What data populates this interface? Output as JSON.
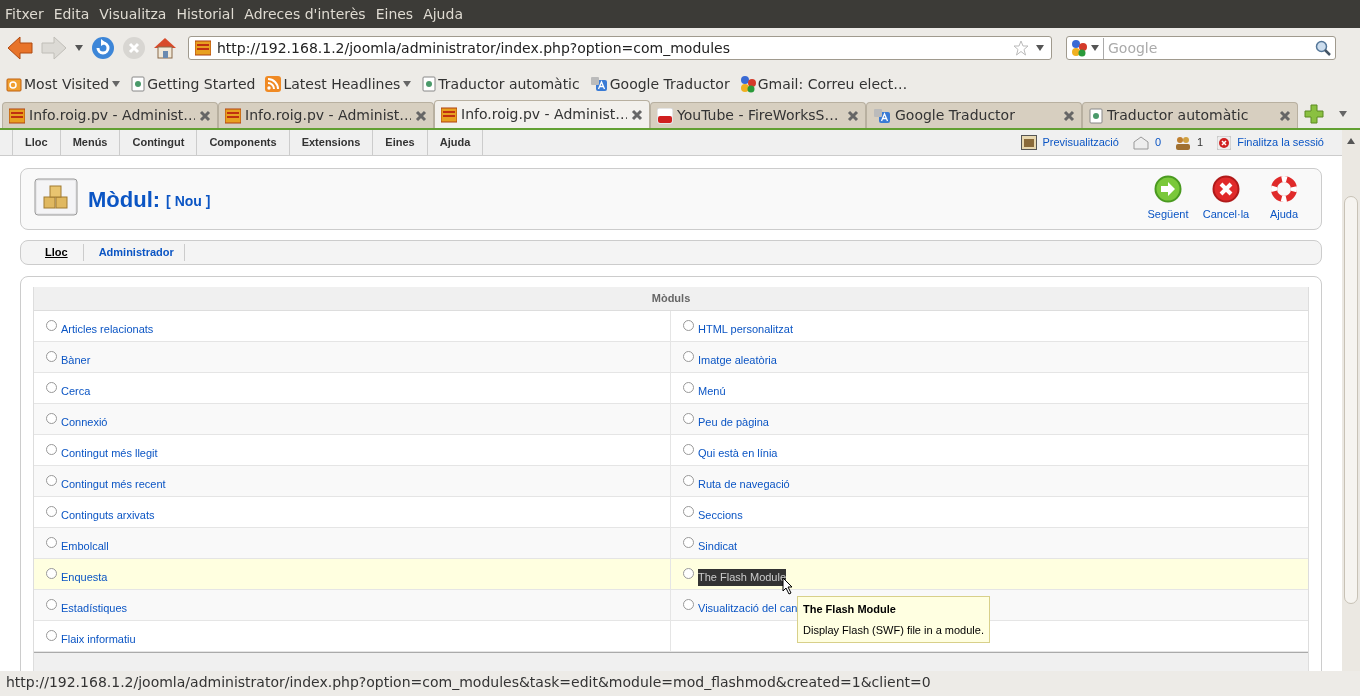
{
  "menu_bar": [
    "Fitxer",
    "Edita",
    "Visualitza",
    "Historial",
    "Adreces d'interès",
    "Eines",
    "Ajuda"
  ],
  "address_bar": {
    "url": "http://192.168.1.2/joomla/administrator/index.php?option=com_modules"
  },
  "search_field": {
    "placeholder": "Google"
  },
  "bookmarks": [
    {
      "label": "Most Visited",
      "kind": "folder",
      "dropdown": true
    },
    {
      "label": "Getting Started",
      "kind": "page",
      "dropdown": false
    },
    {
      "label": "Latest Headlines",
      "kind": "feed",
      "dropdown": true
    },
    {
      "label": "Traductor automàtic",
      "kind": "page",
      "dropdown": false
    },
    {
      "label": "Google Traductor",
      "kind": "translate",
      "dropdown": false
    },
    {
      "label": "Gmail: Correu elect…",
      "kind": "google",
      "dropdown": false
    }
  ],
  "tabs": [
    {
      "label": "Info.roig.pv - Administ…",
      "kind": "site",
      "selected": false
    },
    {
      "label": "Info.roig.pv - Administ…",
      "kind": "site",
      "selected": false
    },
    {
      "label": "Info.roig.pv - Administ…",
      "kind": "site",
      "selected": true
    },
    {
      "label": "YouTube - FireWorksS…",
      "kind": "video",
      "selected": false
    },
    {
      "label": "Google Traductor",
      "kind": "translate",
      "selected": false
    },
    {
      "label": "Traductor automàtic",
      "kind": "page",
      "selected": false
    }
  ],
  "admin_menu": [
    "Lloc",
    "Menús",
    "Contingut",
    "Components",
    "Extensions",
    "Eines",
    "Ajuda"
  ],
  "admin_status": {
    "preview": "Previsualització",
    "messages": "0",
    "users": "1",
    "logout": "Finalitza la sessió"
  },
  "page_title": "Mòdul:",
  "page_subtitle": "[ Nou ]",
  "toolbar_buttons": [
    {
      "label": "Següent",
      "kind": "next"
    },
    {
      "label": "Cancel·la",
      "kind": "cancel"
    },
    {
      "label": "Ajuda",
      "kind": "help"
    }
  ],
  "sub_tabs": [
    {
      "label": "Lloc",
      "selected": true
    },
    {
      "label": "Administrador",
      "selected": false
    }
  ],
  "modules_table": {
    "heading": "Mòduls",
    "rows": [
      {
        "hovered": false,
        "cells": [
          {
            "label": "Articles relacionats",
            "checked": false,
            "text_selected": false
          },
          {
            "label": "HTML personalitzat",
            "checked": false,
            "text_selected": false
          }
        ]
      },
      {
        "hovered": false,
        "cells": [
          {
            "label": "Bàner",
            "checked": false,
            "text_selected": false
          },
          {
            "label": "Imatge aleatòria",
            "checked": false,
            "text_selected": false
          }
        ]
      },
      {
        "hovered": false,
        "cells": [
          {
            "label": "Cerca",
            "checked": false,
            "text_selected": false
          },
          {
            "label": "Menú",
            "checked": false,
            "text_selected": false
          }
        ]
      },
      {
        "hovered": false,
        "cells": [
          {
            "label": "Connexió",
            "checked": false,
            "text_selected": false
          },
          {
            "label": "Peu de pàgina",
            "checked": false,
            "text_selected": false
          }
        ]
      },
      {
        "hovered": false,
        "cells": [
          {
            "label": "Contingut més llegit",
            "checked": false,
            "text_selected": false
          },
          {
            "label": "Qui està en línia",
            "checked": false,
            "text_selected": false
          }
        ]
      },
      {
        "hovered": false,
        "cells": [
          {
            "label": "Contingut més recent",
            "checked": false,
            "text_selected": false
          },
          {
            "label": "Ruta de navegació",
            "checked": false,
            "text_selected": false
          }
        ]
      },
      {
        "hovered": false,
        "cells": [
          {
            "label": "Continguts arxivats",
            "checked": false,
            "text_selected": false
          },
          {
            "label": "Seccions",
            "checked": false,
            "text_selected": false
          }
        ]
      },
      {
        "hovered": false,
        "cells": [
          {
            "label": "Embolcall",
            "checked": false,
            "text_selected": false
          },
          {
            "label": "Sindicat",
            "checked": false,
            "text_selected": false
          }
        ]
      },
      {
        "hovered": true,
        "cells": [
          {
            "label": "Enquesta",
            "checked": false,
            "text_selected": false
          },
          {
            "label": "The Flash Module",
            "checked": false,
            "text_selected": true
          }
        ]
      },
      {
        "hovered": false,
        "cells": [
          {
            "label": "Estadístiques",
            "checked": false,
            "text_selected": false
          },
          {
            "label": "Visualització del can",
            "checked": false,
            "text_selected": false
          }
        ]
      },
      {
        "hovered": false,
        "cells": [
          {
            "label": "Flaix informatiu",
            "checked": false,
            "text_selected": false
          }
        ]
      }
    ]
  },
  "tooltip": {
    "title": "The Flash Module",
    "text": "Display Flash (SWF) file in a module."
  },
  "status_bar": "http://192.168.1.2/joomla/administrator/index.php?option=com_modules&task=edit&module=mod_flashmod&created=1&client=0"
}
